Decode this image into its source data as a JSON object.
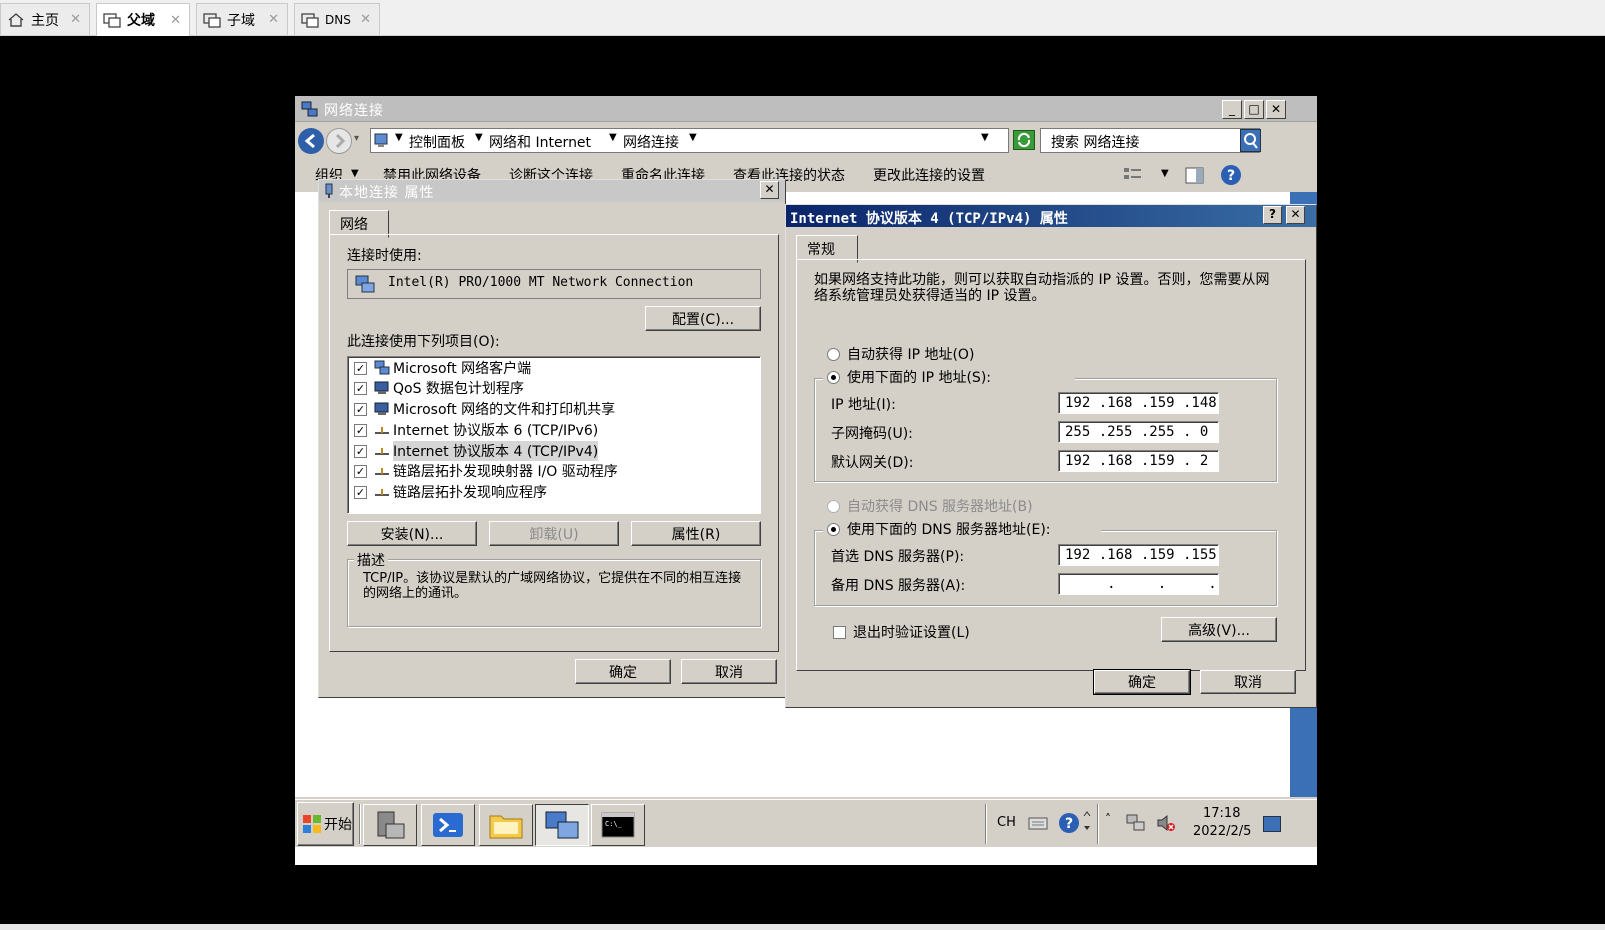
{
  "host_tabs": [
    {
      "label": "主页",
      "active": false
    },
    {
      "label": "父域",
      "active": true
    },
    {
      "label": "子域",
      "active": false
    },
    {
      "label": "DNS",
      "active": false
    }
  ],
  "explorer": {
    "title": "网络连接",
    "breadcrumb": [
      "控制面板",
      "网络和 Internet",
      "网络连接"
    ],
    "search_placeholder": "搜索 网络连接",
    "commands": [
      "组织",
      "禁用此网络设备",
      "诊断这个连接",
      "重命名此连接",
      "查看此连接的状态",
      "更改此连接的设置"
    ]
  },
  "local_props": {
    "title": "本地连接 属性",
    "tab": "网络",
    "connect_using_label": "连接时使用:",
    "adapter": "Intel(R) PRO/1000 MT Network Connection",
    "configure_button": "配置(C)...",
    "items_label": "此连接使用下列项目(O):",
    "items": [
      {
        "label": "Microsoft 网络客户端",
        "checked": true,
        "icon": "network-client-icon",
        "selected": false
      },
      {
        "label": "QoS 数据包计划程序",
        "checked": true,
        "icon": "qos-icon",
        "selected": false
      },
      {
        "label": "Microsoft 网络的文件和打印机共享",
        "checked": true,
        "icon": "file-share-icon",
        "selected": false
      },
      {
        "label": "Internet 协议版本 6 (TCP/IPv6)",
        "checked": true,
        "icon": "protocol-icon",
        "selected": false
      },
      {
        "label": "Internet 协议版本 4 (TCP/IPv4)",
        "checked": true,
        "icon": "protocol-icon",
        "selected": true
      },
      {
        "label": "链路层拓扑发现映射器 I/O 驱动程序",
        "checked": true,
        "icon": "protocol-icon",
        "selected": false
      },
      {
        "label": "链路层拓扑发现响应程序",
        "checked": true,
        "icon": "protocol-icon",
        "selected": false
      }
    ],
    "install_button": "安装(N)...",
    "uninstall_button": "卸载(U)",
    "properties_button": "属性(R)",
    "description_label": "描述",
    "description": "TCP/IP。该协议是默认的广域网络协议，它提供在不同的相互连接的网络上的通讯。",
    "ok_button": "确定",
    "cancel_button": "取消"
  },
  "ipv4_props": {
    "title": "Internet 协议版本 4 (TCP/IPv4) 属性",
    "help_glyph": "?",
    "tab": "常规",
    "intro": "如果网络支持此功能，则可以获取自动指派的 IP 设置。否则，您需要从网络系统管理员处获得适当的 IP 设置。",
    "auto_ip_label": "自动获得 IP 地址(O)",
    "manual_ip_label": "使用下面的 IP 地址(S):",
    "ip_label": "IP 地址(I):",
    "ip_value": "192 .168 .159 .148",
    "mask_label": "子网掩码(U):",
    "mask_value": "255 .255 .255 . 0",
    "gateway_label": "默认网关(D):",
    "gateway_value": "192 .168 .159 . 2",
    "auto_dns_label": "自动获得 DNS 服务器地址(B)",
    "manual_dns_label": "使用下面的 DNS 服务器地址(E):",
    "preferred_dns_label": "首选 DNS 服务器(P):",
    "preferred_dns_value": "192 .168 .159 .155",
    "alternate_dns_label": "备用 DNS 服务器(A):",
    "alternate_dns_value": "     .     .     .",
    "validate_label": "退出时验证设置(L)",
    "advanced_button": "高级(V)...",
    "ok_button": "确定",
    "cancel_button": "取消"
  },
  "taskbar": {
    "start_label": "开始",
    "lang": "CH",
    "time": "17:18",
    "date": "2022/2/5"
  }
}
